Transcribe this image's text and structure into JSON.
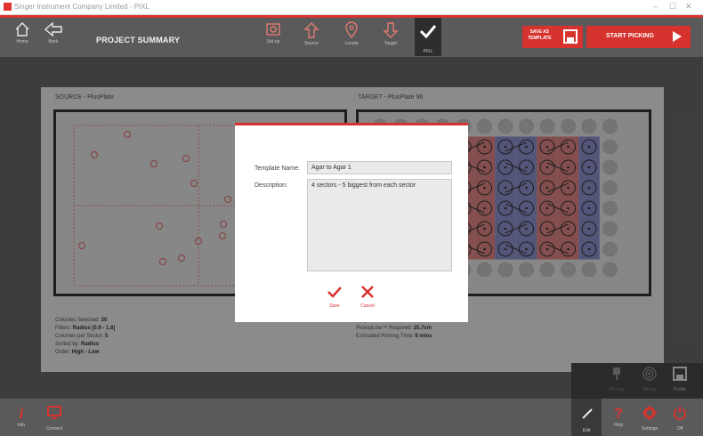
{
  "window": {
    "title": "Singer Instrument Company Limited - PIXL",
    "controls": [
      "–",
      "☐",
      "✕"
    ]
  },
  "toolbar": {
    "home_label": "Home",
    "back_label": "Back",
    "title": "PROJECT SUMMARY",
    "steps": [
      {
        "label": "Set-up",
        "icon": "camera-icon"
      },
      {
        "label": "Source",
        "icon": "upload-arrow-icon"
      },
      {
        "label": "Locate",
        "icon": "location-pin-icon"
      },
      {
        "label": "Target",
        "icon": "download-arrow-icon"
      },
      {
        "label": "PIXL",
        "icon": "checkmark-icon"
      }
    ],
    "save_template_label": "SAVE AS\nTEMPLATE",
    "start_picking_label": "START PICKING"
  },
  "summary": {
    "source_label": "SOURCE -  PlusPlate",
    "target_label": "TARGET -  PlusPlate 96",
    "left_info": [
      {
        "key": "Colonies Selected:",
        "value": "20"
      },
      {
        "key": "Filters:",
        "value": "Radius [0.9 - 1.8]"
      },
      {
        "key": "Colonies per Sector:",
        "value": "5"
      },
      {
        "key": "Sorted by:",
        "value": "Radius"
      },
      {
        "key": "Order:",
        "value": "High - Low"
      }
    ],
    "right_info": [
      {
        "key": "Target Plates Required:",
        "value": "1"
      },
      {
        "key": "PickupLine™ Required:",
        "value": "25.7cm"
      },
      {
        "key": "Estimated Pinning Time:",
        "value": "8 mins"
      }
    ]
  },
  "dialog": {
    "template_name_label": "Template Name:",
    "template_name_value": "Agar to Agar 1",
    "description_label": "Description:",
    "description_value": "4 sectors - 5 biggest from each sector",
    "save_label": "Save",
    "cancel_label": "Cancel"
  },
  "side_panel": {
    "items": [
      {
        "label": "Pinning",
        "icon": "pin-tool-icon"
      },
      {
        "label": "Mixing",
        "icon": "spiral-icon"
      },
      {
        "label": "Profile",
        "icon": "save-disk-icon"
      }
    ]
  },
  "bottombar": {
    "info_label": "Info",
    "connect_label": "Connect",
    "edit_label": "Edit",
    "help_label": "Help",
    "settings_label": "Settings",
    "off_label": "Off"
  },
  "colors": {
    "accent": "#d6332f",
    "toolbar": "#5a5a5a",
    "well_blue": "#8f93d1",
    "well_red": "#e48787"
  }
}
